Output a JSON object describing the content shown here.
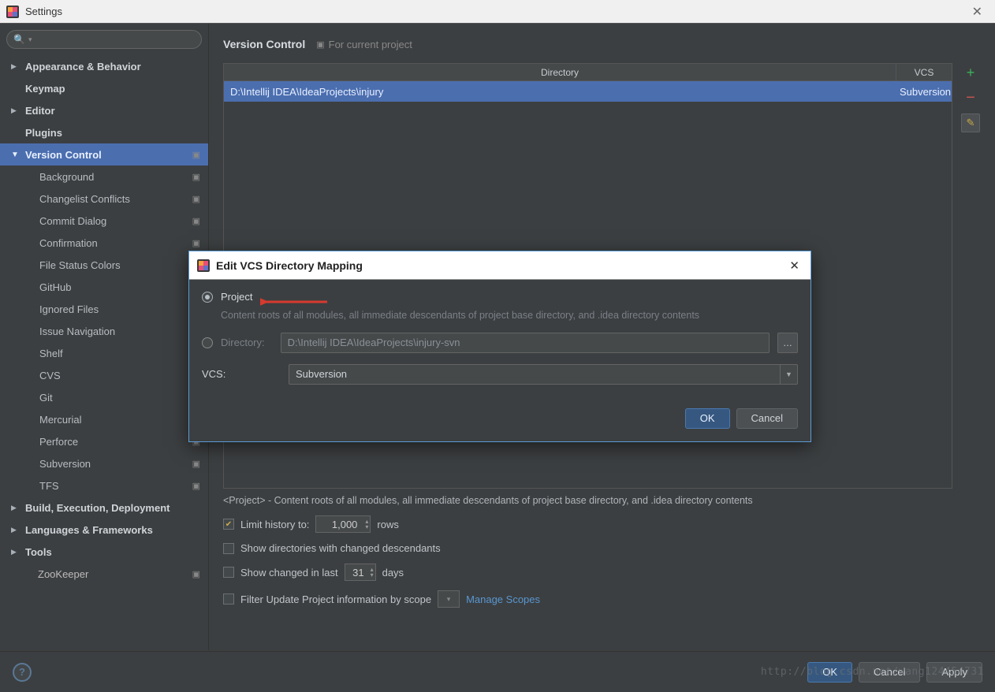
{
  "window": {
    "title": "Settings"
  },
  "search": {
    "placeholder": ""
  },
  "sidebar": {
    "items": [
      {
        "label": "Appearance & Behavior",
        "bold": true,
        "arrow": "right"
      },
      {
        "label": "Keymap",
        "bold": true
      },
      {
        "label": "Editor",
        "bold": true,
        "arrow": "right"
      },
      {
        "label": "Plugins",
        "bold": true
      },
      {
        "label": "Version Control",
        "bold": true,
        "arrow": "down",
        "selected": true,
        "copy": true
      },
      {
        "label": "Background",
        "child": true,
        "copy": true
      },
      {
        "label": "Changelist Conflicts",
        "child": true,
        "copy": true
      },
      {
        "label": "Commit Dialog",
        "child": true,
        "copy": true
      },
      {
        "label": "Confirmation",
        "child": true,
        "copy": true
      },
      {
        "label": "File Status Colors",
        "child": true
      },
      {
        "label": "GitHub",
        "child": true,
        "copy": true
      },
      {
        "label": "Ignored Files",
        "child": true,
        "copy": true
      },
      {
        "label": "Issue Navigation",
        "child": true,
        "copy": true
      },
      {
        "label": "Shelf",
        "child": true,
        "copy": true
      },
      {
        "label": "CVS",
        "child": true
      },
      {
        "label": "Git",
        "child": true,
        "copy": true
      },
      {
        "label": "Mercurial",
        "child": true,
        "copy": true
      },
      {
        "label": "Perforce",
        "child": true,
        "copy": true
      },
      {
        "label": "Subversion",
        "child": true,
        "arrow": "right",
        "copy": true
      },
      {
        "label": "TFS",
        "child": true,
        "copy": true
      },
      {
        "label": "Build, Execution, Deployment",
        "bold": true,
        "arrow": "right"
      },
      {
        "label": "Languages & Frameworks",
        "bold": true,
        "arrow": "right"
      },
      {
        "label": "Tools",
        "bold": true,
        "arrow": "right"
      },
      {
        "label": "ZooKeeper",
        "child": false,
        "padLeft": true,
        "copy": true
      }
    ]
  },
  "content": {
    "breadcrumb": "Version Control",
    "for_project": "For current project",
    "table": {
      "headers": {
        "dir": "Directory",
        "vcs": "VCS"
      },
      "rows": [
        {
          "dir": "D:\\Intellij IDEA\\IdeaProjects\\injury",
          "vcs": "Subversion"
        }
      ]
    },
    "info": "<Project> - Content roots of all modules, all immediate descendants of project base directory, and .idea directory contents",
    "opts": {
      "limit_label": "Limit history to:",
      "limit_value": "1,000",
      "rows_label": "rows",
      "show_dirs": "Show directories with changed descendants",
      "show_changed": "Show changed in last",
      "show_changed_value": "31",
      "days_label": "days",
      "filter_scope": "Filter Update Project information by scope",
      "manage_scopes": "Manage Scopes"
    }
  },
  "bottom": {
    "ok": "OK",
    "cancel": "Cancel",
    "apply": "Apply"
  },
  "dialog": {
    "title": "Edit VCS Directory Mapping",
    "project_label": "Project",
    "project_desc": "Content roots of all modules, all immediate descendants of project base directory, and .idea directory contents",
    "directory_label": "Directory:",
    "directory_value": "D:\\Intellij IDEA\\IdeaProjects\\injury-svn",
    "vcs_label": "VCS:",
    "vcs_value": "Subversion",
    "ok": "OK",
    "cancel": "Cancel"
  },
  "watermark": "http://blog.csdn.net/wang124454731"
}
